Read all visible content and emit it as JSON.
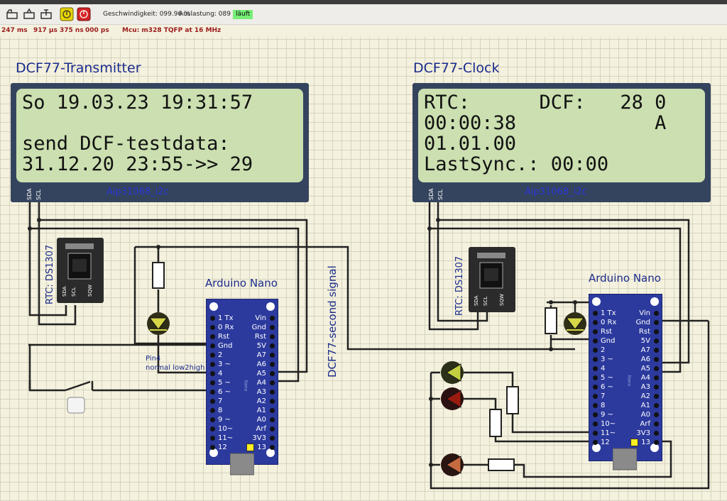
{
  "toolbar": {
    "speed": "Geschwindigkeit: 099.96 %",
    "load": "Auslastung: 089 %",
    "status": "läuft",
    "icons": [
      "folder-icon",
      "folder-open-icon",
      "folder-save-icon",
      "circuit-icon",
      "pause-icon",
      "stop-icon"
    ],
    "colors": {
      "pause": "#e8d400",
      "stop": "#d42424",
      "status_bg": "#77ee77"
    }
  },
  "infobar": {
    "t1": "247 ms",
    "t2": "917 µs",
    "t3": "375 ns",
    "t4": "000 ps",
    "mcu": "Mcu: m328 TQFP at 16 MHz"
  },
  "transmitter": {
    "title": "DCF77-Transmitter",
    "lcd_lines": [
      "So 19.03.23 19:31:57",
      "",
      "send DCF-testdata:",
      "31.12.20 23:55->> 29"
    ],
    "chip": "Aip31068_i2c",
    "pins": [
      "SDA",
      "SCL"
    ],
    "rtc_label": "RTC: DS1307",
    "rtc_pins": [
      "SDA",
      "SCL",
      "SQW"
    ],
    "nano_title": "Arduino Nano",
    "pin_note_1": "Pin4",
    "pin_note_2": "normal low2high"
  },
  "clock": {
    "title": "DCF77-Clock",
    "lcd_lines": [
      "RTC:      DCF:   28 0",
      "00:00:38            A",
      "01.01.00",
      "LastSync.: 00:00"
    ],
    "chip": "Aip31068_i2c",
    "pins": [
      "SDA",
      "SCL"
    ],
    "rtc_label": "RTC: DS1307",
    "rtc_pins": [
      "SDA",
      "SCL",
      "SQW"
    ],
    "nano_title": "Arduino Nano"
  },
  "signal_label": "DCF77-second signal",
  "nano": {
    "left_pins": [
      "1 Tx",
      "0 Rx",
      "Rst",
      "Gnd",
      "2",
      "3 ~",
      "4",
      "5 ~",
      "6 ~",
      "7",
      "8",
      "9 ~",
      "10~",
      "11~",
      "12"
    ],
    "right_pins": [
      "Vin",
      "Gnd",
      "Rst",
      "5V",
      "A7",
      "A6",
      "A5",
      "A4",
      "A3",
      "A2",
      "A1",
      "A0",
      "Arf",
      "3V3",
      "13"
    ],
    "side_text": "Nano"
  }
}
